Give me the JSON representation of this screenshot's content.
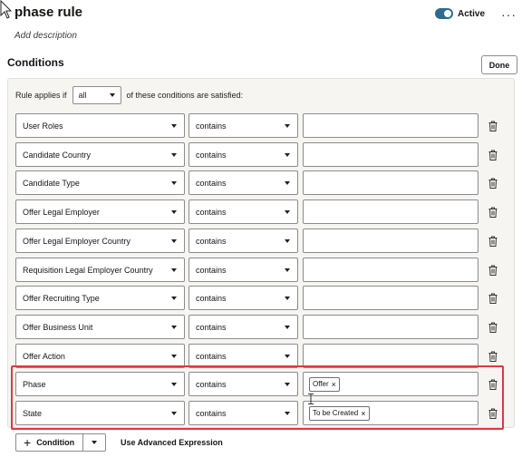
{
  "header": {
    "title": "phase rule",
    "add_description": "Add description",
    "active_label": "Active",
    "active_on": true,
    "more_label": "···"
  },
  "conditions": {
    "section_title": "Conditions",
    "done_label": "Done",
    "applies_prefix": "Rule applies if",
    "applies_value": "all",
    "applies_suffix": "of these conditions are satisfied:",
    "rows": [
      {
        "field": "User Roles",
        "operator": "contains",
        "values": []
      },
      {
        "field": "Candidate Country",
        "operator": "contains",
        "values": []
      },
      {
        "field": "Candidate Type",
        "operator": "contains",
        "values": []
      },
      {
        "field": "Offer Legal Employer",
        "operator": "contains",
        "values": []
      },
      {
        "field": "Offer Legal Employer Country",
        "operator": "contains",
        "values": []
      },
      {
        "field": "Requisition Legal Employer Country",
        "operator": "contains",
        "values": []
      },
      {
        "field": "Offer Recruiting Type",
        "operator": "contains",
        "values": []
      },
      {
        "field": "Offer Business Unit",
        "operator": "contains",
        "values": []
      },
      {
        "field": "Offer Action",
        "operator": "contains",
        "values": []
      },
      {
        "field": "Phase",
        "operator": "contains",
        "values": [
          "Offer"
        ]
      },
      {
        "field": "State",
        "operator": "contains",
        "values": [
          "To be Created"
        ]
      }
    ],
    "add_condition_label": "Condition",
    "advanced_label": "Use Advanced Expression"
  },
  "colors": {
    "highlight": "#e0393e",
    "toggle": "#2e6b8f"
  },
  "icons": {
    "delete": "trash-icon",
    "chip_remove": "close-icon",
    "add": "plus-icon"
  }
}
